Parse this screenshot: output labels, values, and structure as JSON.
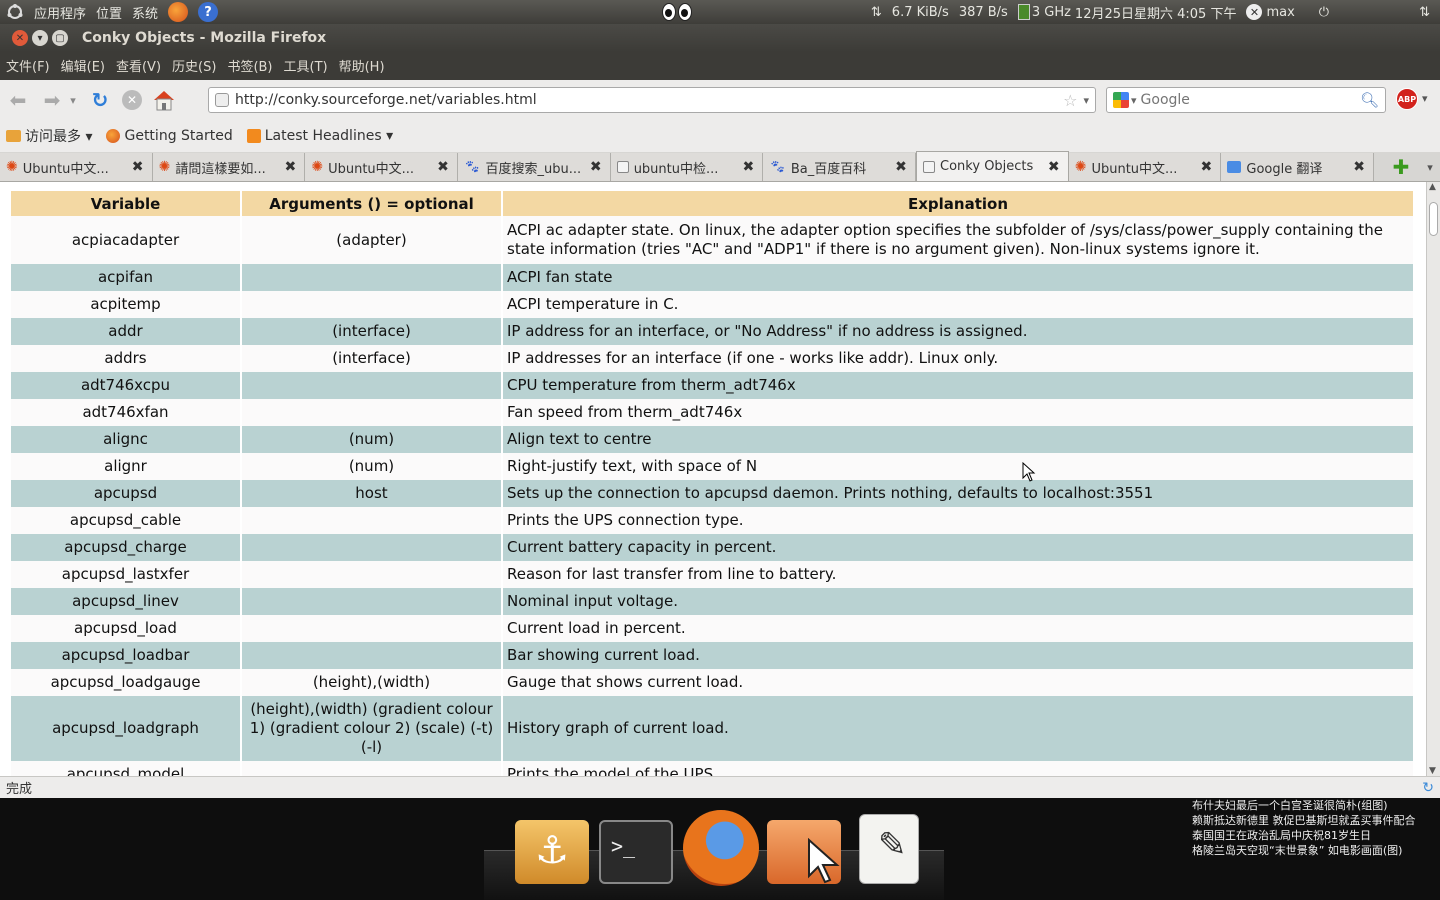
{
  "panel": {
    "menu_apps": "应用程序",
    "menu_places": "位置",
    "menu_system": "系统",
    "net_down": "6.7 KiB/s",
    "net_up": "387 B/s",
    "cpu": "3 GHz",
    "clock": "12月25日星期六 4:05 下午",
    "user": "max"
  },
  "window": {
    "title": "Conky Objects - Mozilla Firefox"
  },
  "menubar": [
    "文件(F)",
    "编辑(E)",
    "查看(V)",
    "历史(S)",
    "书签(B)",
    "工具(T)",
    "帮助(H)"
  ],
  "nav": {
    "url": "http://conky.sourceforge.net/variables.html",
    "search_placeholder": "Google"
  },
  "bookmarks": [
    "访问最多 ▾",
    "Getting Started",
    "Latest Headlines ▾"
  ],
  "tabs": [
    {
      "label": "Ubuntu中文...",
      "active": false
    },
    {
      "label": "請問這樣要如...",
      "active": false
    },
    {
      "label": "Ubuntu中文...",
      "active": false
    },
    {
      "label": "百度搜索_ubu...",
      "active": false
    },
    {
      "label": "ubuntu中检...",
      "active": false
    },
    {
      "label": "Ba_百度百科",
      "active": false
    },
    {
      "label": "Conky Objects",
      "active": true
    },
    {
      "label": "Ubuntu中文...",
      "active": false
    },
    {
      "label": "Google 翻译",
      "active": false
    }
  ],
  "table": {
    "headers": [
      "Variable",
      "Arguments () = optional",
      "Explanation"
    ],
    "rows": [
      {
        "variable": "acpiacadapter",
        "args": "(adapter)",
        "explanation": "ACPI ac adapter state. On linux, the adapter option specifies the subfolder of /sys/class/power_supply containing the state information (tries \"AC\" and \"ADP1\" if there is no argument given). Non-linux systems ignore it."
      },
      {
        "variable": "acpifan",
        "args": "",
        "explanation": "ACPI fan state"
      },
      {
        "variable": "acpitemp",
        "args": "",
        "explanation": "ACPI temperature in C."
      },
      {
        "variable": "addr",
        "args": "(interface)",
        "explanation": "IP address for an interface, or \"No Address\" if no address is assigned."
      },
      {
        "variable": "addrs",
        "args": "(interface)",
        "explanation": "IP addresses for an interface (if one - works like addr). Linux only."
      },
      {
        "variable": "adt746xcpu",
        "args": "",
        "explanation": "CPU temperature from therm_adt746x"
      },
      {
        "variable": "adt746xfan",
        "args": "",
        "explanation": "Fan speed from therm_adt746x"
      },
      {
        "variable": "alignc",
        "args": "(num)",
        "explanation": "Align text to centre"
      },
      {
        "variable": "alignr",
        "args": "(num)",
        "explanation": "Right-justify text, with space of N"
      },
      {
        "variable": "apcupsd",
        "args": "host",
        "explanation": "Sets up the connection to apcupsd daemon. Prints nothing, defaults to localhost:3551"
      },
      {
        "variable": "apcupsd_cable",
        "args": "",
        "explanation": "Prints the UPS connection type."
      },
      {
        "variable": "apcupsd_charge",
        "args": "",
        "explanation": "Current battery capacity in percent."
      },
      {
        "variable": "apcupsd_lastxfer",
        "args": "",
        "explanation": "Reason for last transfer from line to battery."
      },
      {
        "variable": "apcupsd_linev",
        "args": "",
        "explanation": "Nominal input voltage."
      },
      {
        "variable": "apcupsd_load",
        "args": "",
        "explanation": "Current load in percent."
      },
      {
        "variable": "apcupsd_loadbar",
        "args": "",
        "explanation": "Bar showing current load."
      },
      {
        "variable": "apcupsd_loadgauge",
        "args": "(height),(width)",
        "explanation": "Gauge that shows current load."
      },
      {
        "variable": "apcupsd_loadgraph",
        "args": "(height),(width) (gradient colour 1) (gradient colour 2) (scale) (-t) (-l)",
        "explanation": "History graph of current load."
      },
      {
        "variable": "apcupsd_model",
        "args": "",
        "explanation": "Prints the model of the UPS."
      }
    ]
  },
  "status": "完成",
  "news": [
    "布什夫妇最后一个白宫圣诞很简朴(组图)",
    "赖斯抵达新德里 敦促巴基斯坦就孟买事件配合",
    "泰国国王在政治乱局中庆祝81岁生日",
    "格陵兰岛天空现“末世景象” 如电影画面(图)"
  ]
}
